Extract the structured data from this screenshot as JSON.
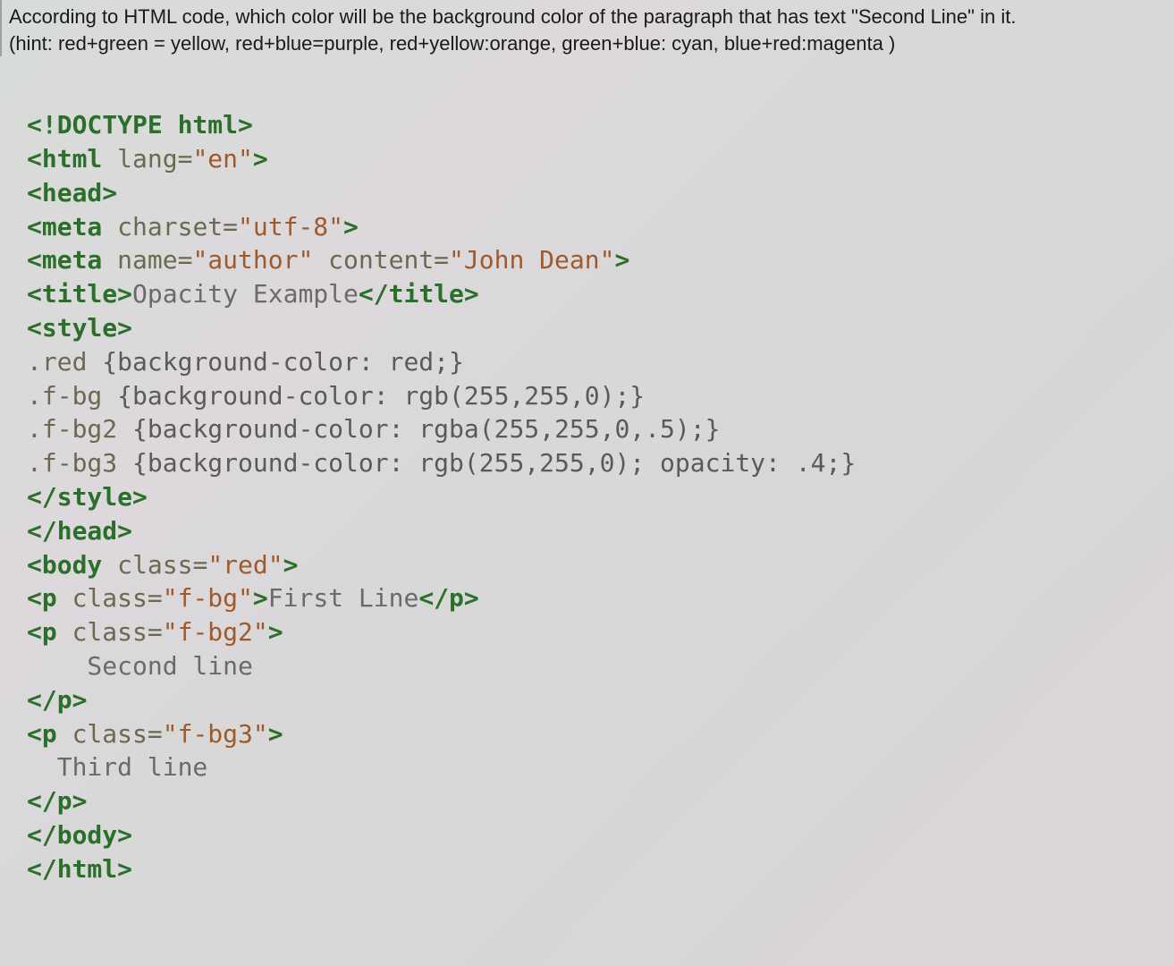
{
  "question": {
    "line1": "According to HTML code, which color will be the background color of the paragraph that has text \"Second Line\" in it.",
    "line2": "(hint: red+green = yellow, red+blue=purple, red+yellow:orange, green+blue: cyan, blue+red:magenta   )"
  },
  "code": {
    "l01_decl": "<!DOCTYPE html>",
    "l02_open": "<html",
    "l02_an": "lang=",
    "l02_av": "\"en\"",
    "l02_close": ">",
    "l03": "<head>",
    "l04_open": "<meta",
    "l04_an": "charset=",
    "l04_av": "\"utf-8\"",
    "l04_close": ">",
    "l05_open": "<meta",
    "l05_an1": "name=",
    "l05_av1": "\"author\"",
    "l05_an2": "content=",
    "l05_av2": "\"John Dean\"",
    "l05_close": ">",
    "l06_open": "<title>",
    "l06_txt": "Opacity Example",
    "l06_close": "</title>",
    "l07": "<style>",
    "l08_sel": ".red ",
    "l08_rule": "{background-color: red;}",
    "l09_sel": ".f-bg ",
    "l09_rule": "{background-color: rgb(255,255,0);}",
    "l10_sel": ".f-bg2 ",
    "l10_rule": "{background-color: rgba(255,255,0,.5);}",
    "l11_sel": ".f-bg3 ",
    "l11_rule": "{background-color: rgb(255,255,0); opacity: .4;}",
    "l12": "</style>",
    "l13": "</head>",
    "l14_open": "<body",
    "l14_an": "class=",
    "l14_av": "\"red\"",
    "l14_close": ">",
    "l15_open": "<p",
    "l15_an": "class=",
    "l15_av": "\"f-bg\"",
    "l15_mid": ">",
    "l15_txt": "First Line",
    "l15_close": "</p>",
    "l16_open": "<p",
    "l16_an": "class=",
    "l16_av": "\"f-bg2\"",
    "l16_close": ">",
    "l17_txt": "    Second line",
    "l18": "</p>",
    "l19_open": "<p",
    "l19_an": "class=",
    "l19_av": "\"f-bg3\"",
    "l19_close": ">",
    "l20_txt": "  Third line",
    "l21": "</p>",
    "l22": "</body>",
    "l23": "</html>"
  }
}
